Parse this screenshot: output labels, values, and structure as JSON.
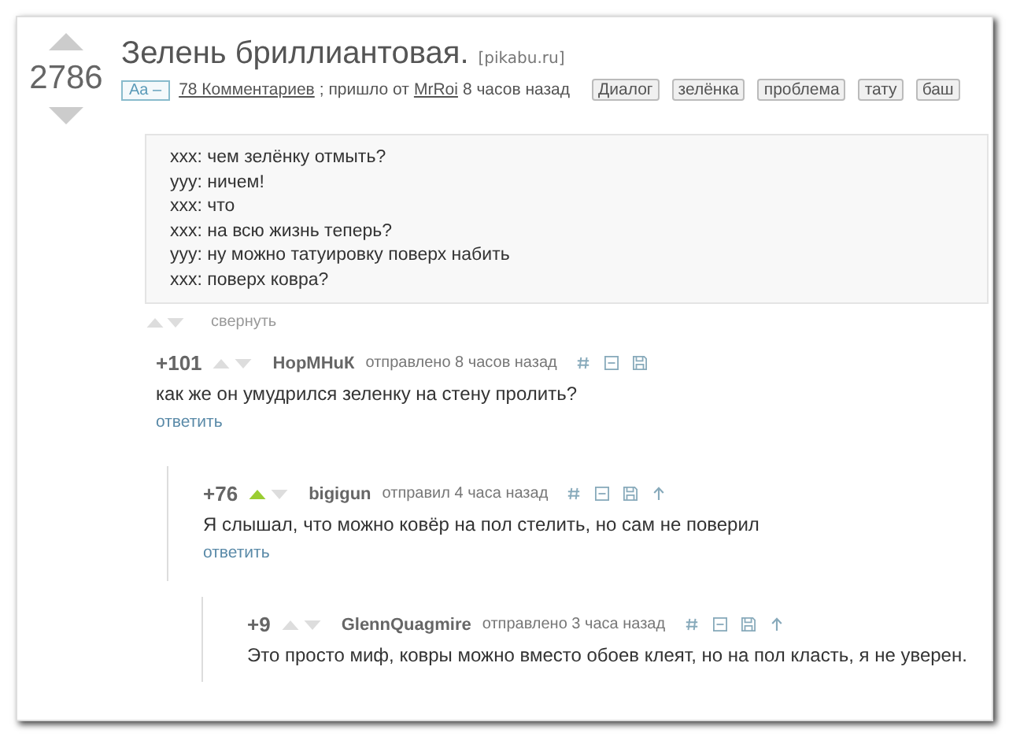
{
  "post": {
    "score": "2786",
    "title": "Зелень бриллиантовая.",
    "source": "[pikabu.ru]",
    "font_toggle": "Aa –",
    "comments_link": "78 Комментариев",
    "meta_from": "; пришло от",
    "author": "MrRoi",
    "time": "8 часов назад",
    "tags": [
      "Диалог",
      "зелёнка",
      "проблема",
      "тату",
      "баш"
    ],
    "quote": [
      "ххх: чем зелёнку отмыть?",
      "ууу: ничем!",
      "ххх: что",
      "ххх: на всю жизнь теперь?",
      "ууу: ну можно татуировку поверх набить",
      "ххх: поверх ковра?"
    ],
    "collapse": "свернуть"
  },
  "comments": [
    {
      "score": "+101",
      "upvoted": false,
      "author": "НорМНuК",
      "time": "отправлено 8 часов назад",
      "has_parent_link": false,
      "text": "как же он умудрился зеленку на стену пролить?",
      "reply": "ответить",
      "children": [
        {
          "score": "+76",
          "upvoted": true,
          "author": "bigigun",
          "time": "отправил 4 часа назад",
          "has_parent_link": true,
          "text": "Я слышал, что можно ковёр на пол стелить, но сам не поверил",
          "reply": "ответить",
          "children": [
            {
              "score": "+9",
              "upvoted": false,
              "author": "GlennQuagmire",
              "time": "отправлено 3 часа назад",
              "has_parent_link": true,
              "text": "Это просто миф, ковры можно вместо обоев клеят, но на пол класть, я не уверен."
            }
          ]
        }
      ]
    }
  ]
}
